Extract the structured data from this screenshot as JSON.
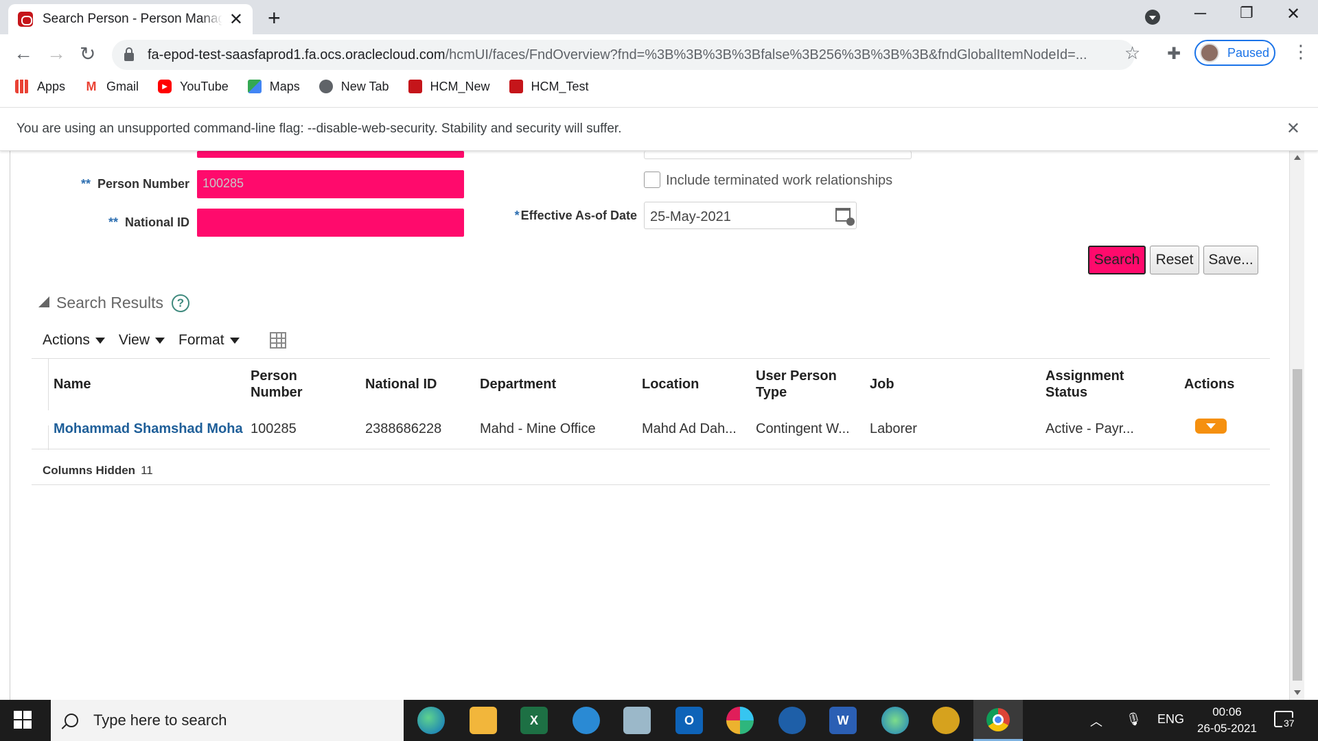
{
  "browser": {
    "tab_title": "Search Person - Person Management",
    "url_host": "fa-epod-test-saasfaprod1.fa.ocs.oraclecloud.com",
    "url_path": "/hcmUI/faces/FndOverview?fnd=%3B%3B%3B%3Bfalse%3B256%3B%3B%3B&fndGlobalItemNodeId=...",
    "profile_label": "Paused",
    "bookmarks": [
      "Apps",
      "Gmail",
      "YouTube",
      "Maps",
      "New Tab",
      "HCM_New",
      "HCM_Test"
    ],
    "infobar_text": "You are using an unsupported command-line flag: --disable-web-security. Stability and security will suffer."
  },
  "form": {
    "person_number_label": "Person Number",
    "person_number_value": "100285",
    "national_id_label": "National ID",
    "required_marker": "**",
    "date_required_marker": "*",
    "include_terminated_label": "Include terminated work relationships",
    "effective_date_label": "Effective As-of Date",
    "effective_date_value": "25-May-2021",
    "accent_color": "#ff0a6c"
  },
  "buttons": {
    "search": "Search",
    "reset": "Reset",
    "save": "Save..."
  },
  "results": {
    "title": "Search Results",
    "help_glyph": "?",
    "menus": [
      "Actions",
      "View",
      "Format"
    ],
    "columns": {
      "name": "Name",
      "person_number": [
        "Person",
        "Number"
      ],
      "national_id": "National ID",
      "department": "Department",
      "location": "Location",
      "user_person_type": [
        "User Person",
        "Type"
      ],
      "job": "Job",
      "assignment_status": [
        "Assignment",
        "Status"
      ],
      "actions": "Actions"
    },
    "rows": [
      {
        "name": "Mohammad Shamshad Moha",
        "person_number": "100285",
        "national_id": "2388686228",
        "department": "Mahd - Mine Office",
        "location": "Mahd Ad Dah...",
        "user_person_type": "Contingent W...",
        "job": "Laborer",
        "assignment_status": "Active - Payr..."
      }
    ],
    "columns_hidden_label": "Columns Hidden",
    "columns_hidden_count": "11"
  },
  "taskbar": {
    "search_placeholder": "Type here to search",
    "language": "ENG",
    "time": "00:06",
    "date": "26-05-2021",
    "notification_count": "37"
  }
}
